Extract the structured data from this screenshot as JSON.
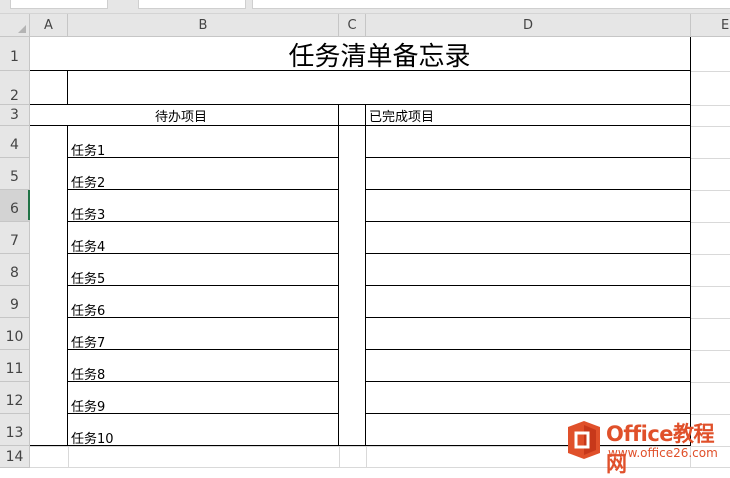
{
  "columns": [
    "A",
    "B",
    "C",
    "D",
    "E"
  ],
  "rows": [
    "1",
    "2",
    "3",
    "4",
    "5",
    "6",
    "7",
    "8",
    "9",
    "10",
    "11",
    "12",
    "13",
    "14"
  ],
  "sheet": {
    "title": "任务清单备忘录",
    "todo_header": "待办项目",
    "done_header": "已完成项目",
    "tasks": [
      "任务1",
      "任务2",
      "任务3",
      "任务4",
      "任务5",
      "任务6",
      "任务7",
      "任务8",
      "任务9",
      "任务10"
    ]
  },
  "watermark": {
    "line1": "Office教程网",
    "line2": "www.office26.com",
    "icon": "office-logo-icon",
    "color": "#e0502a"
  },
  "selection_color": "#217346"
}
